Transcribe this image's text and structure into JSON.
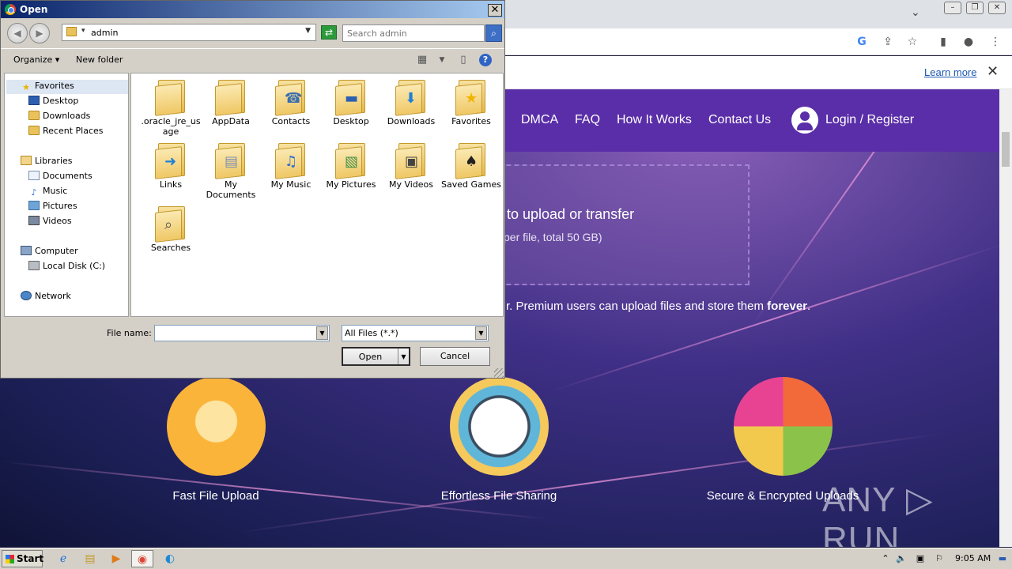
{
  "browser": {
    "infobar_link": "Learn more",
    "nav": [
      "DMCA",
      "FAQ",
      "How It Works",
      "Contact Us",
      "Login / Register"
    ],
    "upload_title": "to upload or transfer",
    "upload_sub": "per file, total 50 GB)",
    "promo_text": "r. Premium users can upload files and store them ",
    "promo_bold": "forever",
    "promo_end": ".",
    "features": [
      "Fast File Upload",
      "Effortless File Sharing",
      "Secure & Encrypted Uploads"
    ],
    "watermark": "ANY ▷ RUN"
  },
  "dialog": {
    "title": "Open",
    "address": "admin",
    "search_placeholder": "Search admin",
    "organize": "Organize",
    "new_folder": "New folder",
    "tree": {
      "favorites": "Favorites",
      "desktop": "Desktop",
      "downloads": "Downloads",
      "recent": "Recent Places",
      "libraries": "Libraries",
      "documents": "Documents",
      "music": "Music",
      "pictures": "Pictures",
      "videos": "Videos",
      "computer": "Computer",
      "local_disk": "Local Disk (C:)",
      "network": "Network"
    },
    "files": [
      {
        "label": ".oracle_jre_usage",
        "icon": "folder-plain"
      },
      {
        "label": "AppData",
        "icon": "folder-plain"
      },
      {
        "label": "Contacts",
        "icon": "folder-contacts"
      },
      {
        "label": "Desktop",
        "icon": "folder-desktop"
      },
      {
        "label": "Downloads",
        "icon": "folder-downloads"
      },
      {
        "label": "Favorites",
        "icon": "folder-favorites"
      },
      {
        "label": "Links",
        "icon": "folder-links"
      },
      {
        "label": "My Documents",
        "icon": "folder-documents"
      },
      {
        "label": "My Music",
        "icon": "folder-music"
      },
      {
        "label": "My Pictures",
        "icon": "folder-pictures"
      },
      {
        "label": "My Videos",
        "icon": "folder-videos"
      },
      {
        "label": "Saved Games",
        "icon": "folder-games"
      },
      {
        "label": "Searches",
        "icon": "folder-searches"
      }
    ],
    "file_name_label": "File name:",
    "file_name_value": "",
    "file_type": "All Files (*.*)",
    "open_btn": "Open",
    "cancel_btn": "Cancel"
  },
  "taskbar": {
    "start": "Start",
    "clock": "9:05 AM"
  }
}
